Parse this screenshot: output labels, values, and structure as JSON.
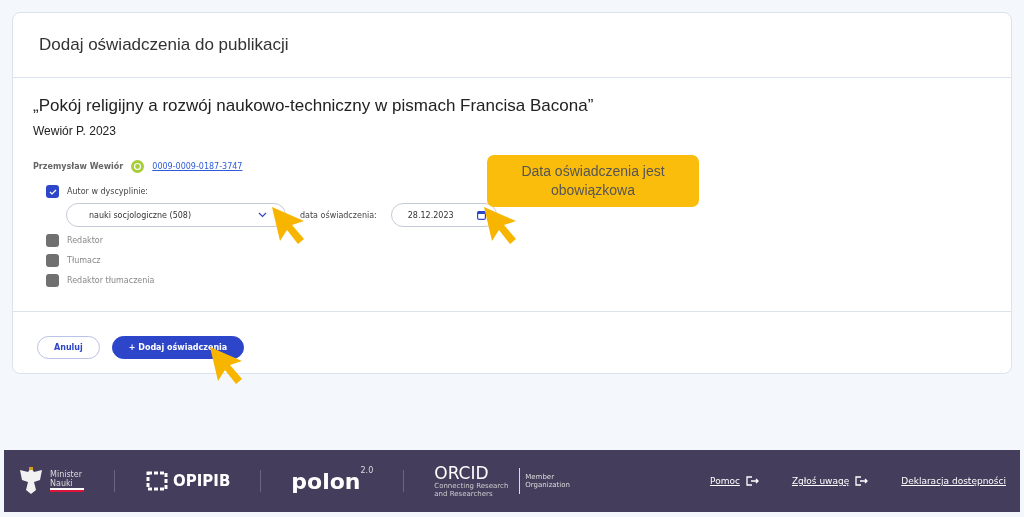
{
  "dialog": {
    "title": "Dodaj oświadczenia do publikacji"
  },
  "publication": {
    "title": "„Pokój religijny a rozwój naukowo-techniczny w pismach Francisa Bacona”",
    "meta": "Wewiór P. 2023"
  },
  "author": {
    "name": "Przemysław Wewiór",
    "orcid": "0009-0009-0187-3747"
  },
  "roles": [
    {
      "label": "Autor w dyscyplinie:",
      "checked": true,
      "discipline": "nauki socjologiczne (508)",
      "date_label": "data oświadczenia:",
      "date": "28.12.2023"
    },
    {
      "label": "Redaktor",
      "checked": false
    },
    {
      "label": "Tłumacz",
      "checked": false
    },
    {
      "label": "Redaktor tłumaczenia",
      "checked": false
    }
  ],
  "callout": {
    "text": "Data oświadczenia jest obowiązkowa"
  },
  "buttons": [
    {
      "label": "Anuluj",
      "kind": "secondary"
    },
    {
      "label": "+ Dodaj oświadczenia",
      "kind": "primary"
    }
  ],
  "footer": {
    "minister": [
      "Minister",
      "Nauki"
    ],
    "opi": "OPIPIB",
    "polon": "polon",
    "polon_version": "2.0",
    "orcid": "ORCID",
    "orcid_tagline": "Connecting Research and Researchers",
    "orcid_member": [
      "Member",
      "Organization"
    ],
    "links": [
      {
        "label": "Pomoc",
        "external": true
      },
      {
        "label": "Zgłoś uwagę",
        "external": true
      },
      {
        "label": "Deklaracja dostępności",
        "external": false
      }
    ]
  }
}
